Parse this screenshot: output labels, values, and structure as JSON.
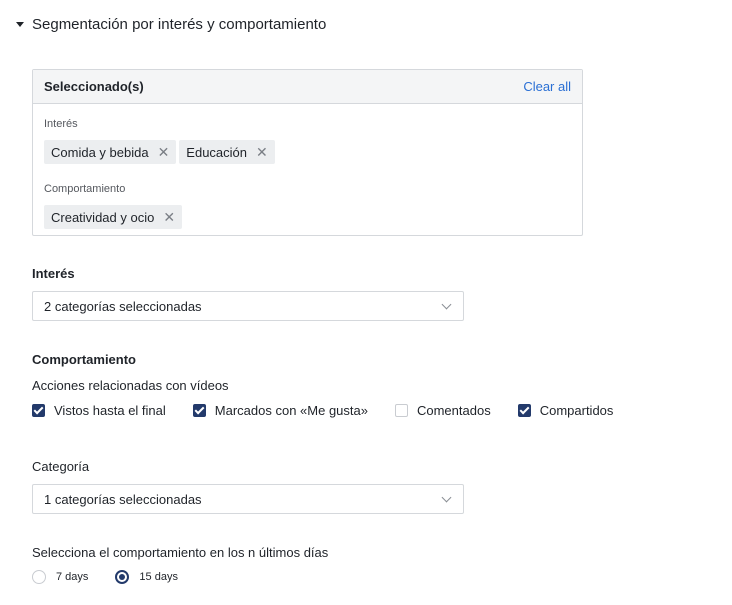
{
  "section": {
    "title": "Segmentación por interés y comportamiento"
  },
  "selected": {
    "title": "Seleccionado(s)",
    "clear_all": "Clear all",
    "groups": [
      {
        "label": "Interés",
        "tags": [
          "Comida y bebida",
          "Educación"
        ]
      },
      {
        "label": "Comportamiento",
        "tags": [
          "Creatividad y ocio"
        ]
      }
    ]
  },
  "interest": {
    "label": "Interés",
    "select_value": "2 categorías seleccionadas"
  },
  "behavior": {
    "label": "Comportamiento",
    "actions_label": "Acciones relacionadas con vídeos",
    "checkboxes": [
      {
        "label": "Vistos hasta el final",
        "checked": true
      },
      {
        "label": "Marcados con «Me gusta»",
        "checked": true
      },
      {
        "label": "Comentados",
        "checked": false
      },
      {
        "label": "Compartidos",
        "checked": true
      }
    ]
  },
  "category": {
    "label": "Categoría",
    "select_value": "1 categorías seleccionadas"
  },
  "period": {
    "label": "Selecciona el comportamiento en los n últimos días",
    "options": [
      {
        "label": "7 days",
        "selected": false
      },
      {
        "label": "15 days",
        "selected": true
      }
    ]
  },
  "colors": {
    "accent": "#233a6b",
    "link": "#2a6fd4",
    "border": "#d5d8dc"
  }
}
